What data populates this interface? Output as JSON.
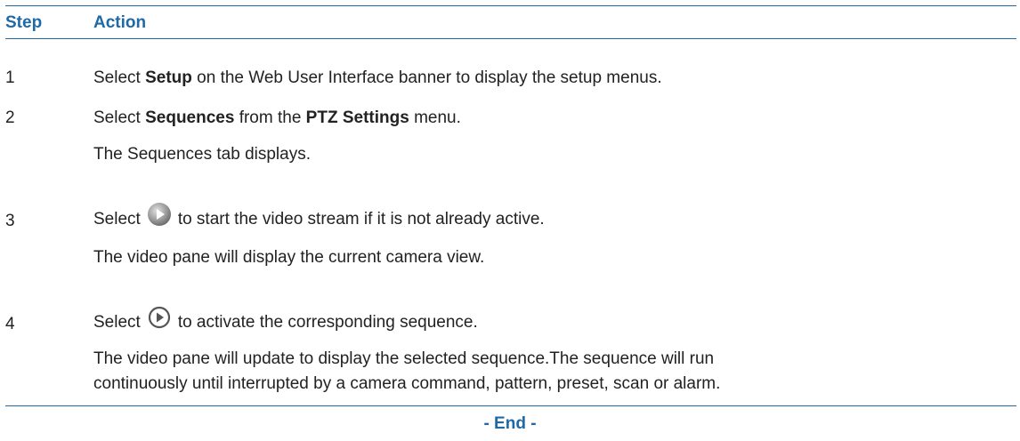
{
  "header": {
    "col_step": "Step",
    "col_action": "Action"
  },
  "steps": [
    {
      "num": "1",
      "pre": "Select ",
      "bold1": "Setup",
      "post": " on the Web User Interface banner to display the setup menus."
    },
    {
      "num": "2",
      "pre": "Select ",
      "bold1": "Sequences",
      "mid": " from the ",
      "bold2": "PTZ Settings",
      "post": " menu.",
      "note": "The Sequences tab displays."
    },
    {
      "num": "3",
      "pre": "Select",
      "icon": "play-stream-icon",
      "post": "to start the video stream if it is not already active.",
      "note": "The video pane will display the current camera view."
    },
    {
      "num": "4",
      "pre": "Select",
      "icon": "activate-sequence-icon",
      "post": "to activate the corresponding sequence.",
      "note1": "The video pane will update to display the selected sequence.The sequence will run",
      "note2": "continuously until interrupted by a camera command, pattern, preset, scan or alarm."
    }
  ],
  "footer": {
    "end_label": "- End -"
  },
  "colors": {
    "accent": "#1f6aa6",
    "text": "#222222"
  }
}
